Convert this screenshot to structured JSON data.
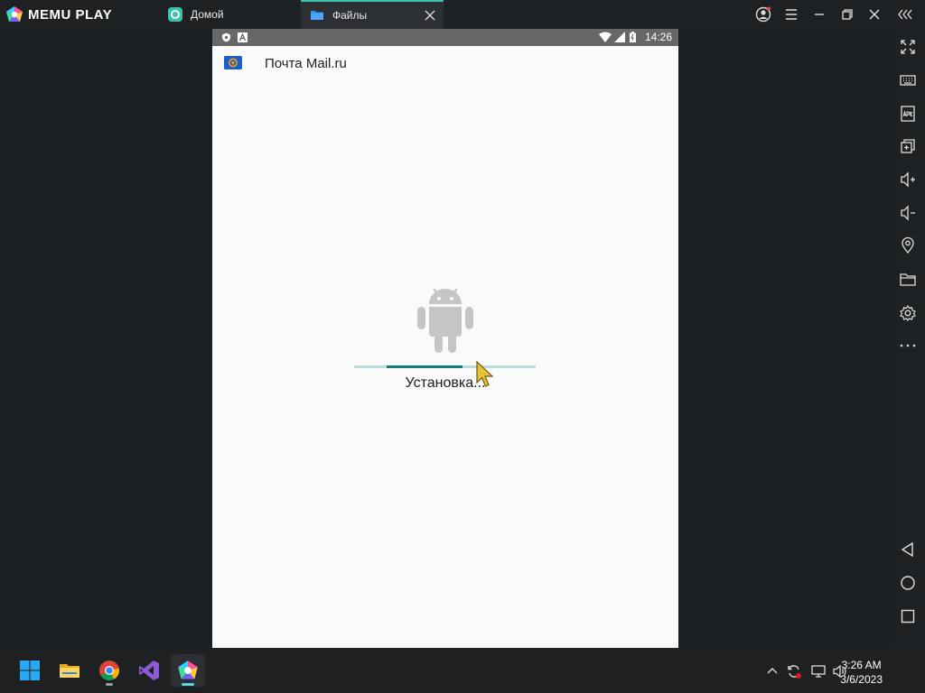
{
  "titlebar": {
    "brand": "MEMU PLAY",
    "tabs": [
      {
        "label": "Домой",
        "active": false
      },
      {
        "label": "Файлы",
        "active": true
      }
    ]
  },
  "android": {
    "status": {
      "time": "14:26"
    },
    "app_title": "Почта Mail.ru",
    "install_text": "Установка...",
    "progress": 0.42
  },
  "taskbar": {
    "time": "3:26 AM",
    "date": "3/6/2023"
  },
  "colors": {
    "accent": "#137f78",
    "track": "#b7dcd9",
    "android_grey": "#c5c5c5",
    "tab_accent": "#3fc2ad"
  }
}
